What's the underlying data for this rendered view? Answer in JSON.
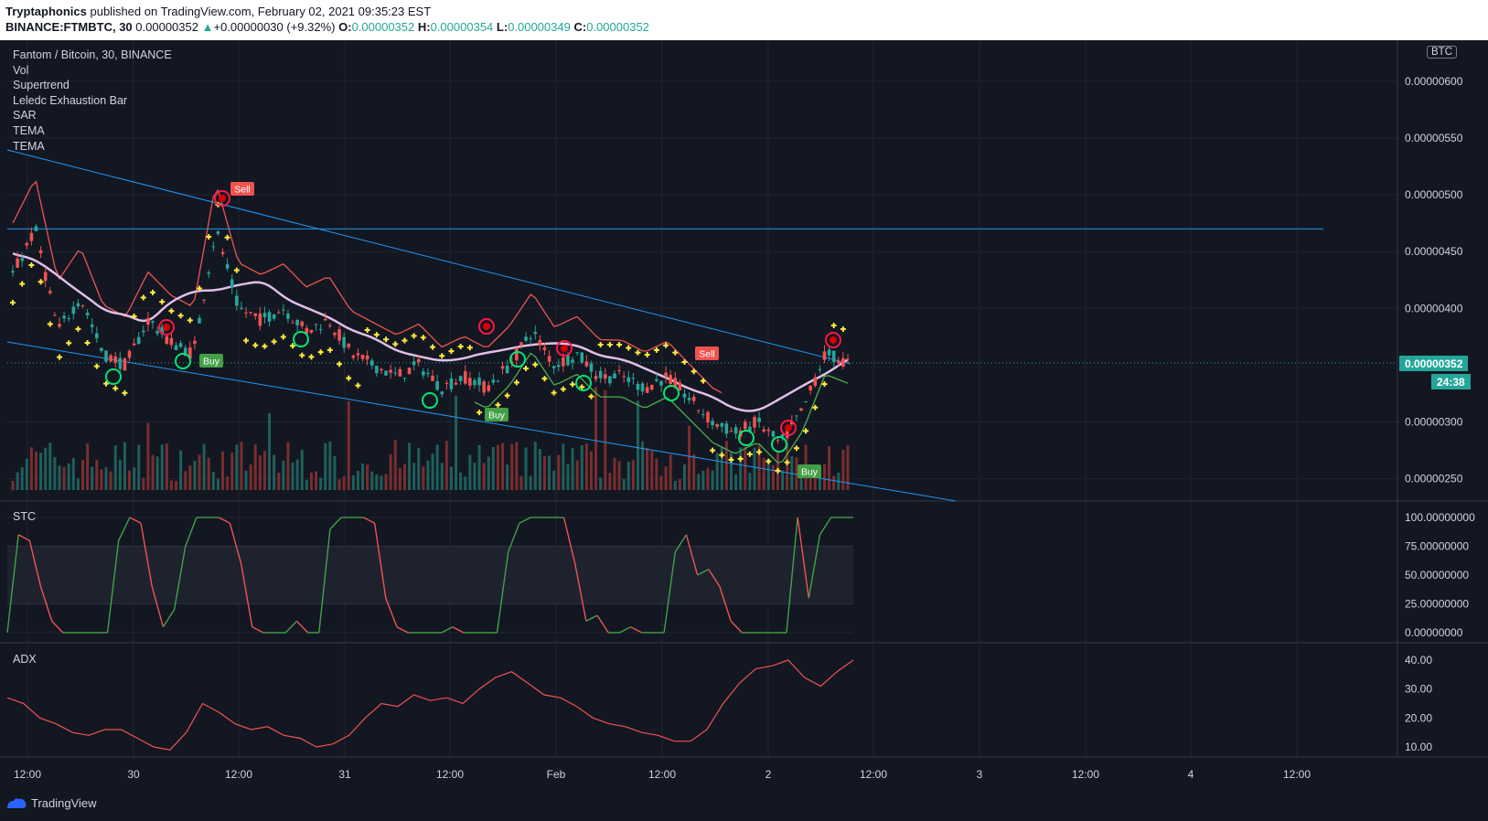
{
  "header": {
    "author": "Tryptaphonics",
    "published_text": "published on TradingView.com, February 02, 2021 09:35:23 EST",
    "symbol": "BINANCE:FTMBTC, 30",
    "last": "0.00000352",
    "change_arrow": "▲",
    "change": "+0.00000030 (+9.32%)",
    "o_label": "O:",
    "o_value": "0.00000352",
    "h_label": "H:",
    "h_value": "0.00000354",
    "l_label": "L:",
    "l_value": "0.00000349",
    "c_label": "C:",
    "c_value": "0.00000352"
  },
  "legend": {
    "title": "Fantom / Bitcoin, 30, BINANCE",
    "indicators": [
      "Vol",
      "Supertrend",
      "Leledc Exhaustion Bar",
      "SAR",
      "TEMA",
      "TEMA"
    ]
  },
  "currency_badge": "BTC",
  "price_axis": [
    "0.00000600",
    "0.00000550",
    "0.00000500",
    "0.00000450",
    "0.00000400",
    "0.00000300",
    "0.00000250"
  ],
  "current_price_label": "0.00000352",
  "bar_timer": "24:38",
  "signals": {
    "sell": "Sell",
    "buy": "Buy"
  },
  "stc": {
    "label": "STC",
    "axis": [
      "100.00000000",
      "75.00000000",
      "50.00000000",
      "25.00000000",
      "0.00000000"
    ]
  },
  "adx": {
    "label": "ADX",
    "axis": [
      "40.00",
      "30.00",
      "20.00",
      "10.00"
    ]
  },
  "time_axis": [
    "12:00",
    "30",
    "12:00",
    "31",
    "12:00",
    "Feb",
    "12:00",
    "2",
    "12:00",
    "3",
    "12:00",
    "4",
    "12:00"
  ],
  "footer": {
    "brand": "TradingView"
  },
  "colors": {
    "background": "#131722",
    "up": "#26a69a",
    "down": "#ef5350",
    "supertrend_down": "#ef5350",
    "supertrend_up": "#4caf50",
    "sar": "#ffeb3b",
    "tema": "#e1bee7",
    "trendline": "#2196f3"
  },
  "chart_data": [
    {
      "type": "candlestick",
      "title": "Fantom / Bitcoin, 30, BINANCE",
      "ylim": [
        2.4e-06,
        6.2e-06
      ],
      "y_ticks": [
        2.5e-06,
        3e-06,
        4e-06,
        4.5e-06,
        5e-06,
        5.5e-06,
        6e-06
      ],
      "x_ticks": [
        "12:00",
        "30",
        "12:00",
        "31",
        "12:00",
        "Feb",
        "12:00",
        "2",
        "12:00",
        "3",
        "12:00",
        "4",
        "12:00"
      ],
      "approx_close": [
        4.3e-06,
        4.7e-06,
        3.8e-06,
        4.1e-06,
        3.6e-06,
        3.5e-06,
        3.9e-06,
        3.7e-06,
        3.6e-06,
        4.7e-06,
        4e-06,
        3.9e-06,
        4e-06,
        3.8e-06,
        3.9e-06,
        3.6e-06,
        3.5e-06,
        3.4e-06,
        3.5e-06,
        3.3e-06,
        3.4e-06,
        3.3e-06,
        3.5e-06,
        3.8e-06,
        3.5e-06,
        3.6e-06,
        3.4e-06,
        3.4e-06,
        3.3e-06,
        3.4e-06,
        3.2e-06,
        3e-06,
        2.9e-06,
        3e-06,
        2.8e-06,
        3.1e-06,
        3.6e-06,
        3.52e-06
      ],
      "horizontal_line": 4.7e-06,
      "current_price": 3.52e-06
    },
    {
      "type": "line",
      "title": "STC",
      "ylim": [
        0,
        100
      ],
      "y_ticks": [
        0,
        25,
        50,
        75,
        100
      ],
      "values": [
        0,
        85,
        80,
        40,
        10,
        0,
        0,
        0,
        0,
        0,
        80,
        100,
        95,
        40,
        5,
        20,
        75,
        100,
        100,
        100,
        95,
        60,
        5,
        0,
        0,
        0,
        10,
        0,
        0,
        90,
        100,
        100,
        100,
        95,
        30,
        5,
        0,
        0,
        0,
        0,
        5,
        0,
        0,
        0,
        0,
        70,
        95,
        100,
        100,
        100,
        100,
        60,
        10,
        15,
        0,
        0,
        5,
        0,
        0,
        0,
        70,
        85,
        50,
        55,
        40,
        10,
        0,
        0,
        0,
        0,
        0,
        100,
        30,
        85,
        100,
        100,
        100
      ]
    },
    {
      "type": "line",
      "title": "ADX",
      "ylim": [
        5,
        45
      ],
      "y_ticks": [
        10,
        20,
        30,
        40
      ],
      "values": [
        27,
        25,
        20,
        18,
        15,
        14,
        16,
        16,
        13,
        10,
        9,
        15,
        25,
        22,
        18,
        16,
        17,
        14,
        13,
        10,
        11,
        14,
        20,
        25,
        24,
        28,
        26,
        27,
        25,
        30,
        34,
        36,
        32,
        28,
        27,
        24,
        20,
        18,
        17,
        15,
        14,
        12,
        12,
        16,
        25,
        32,
        37,
        38,
        40,
        34,
        31,
        36,
        40
      ]
    }
  ]
}
